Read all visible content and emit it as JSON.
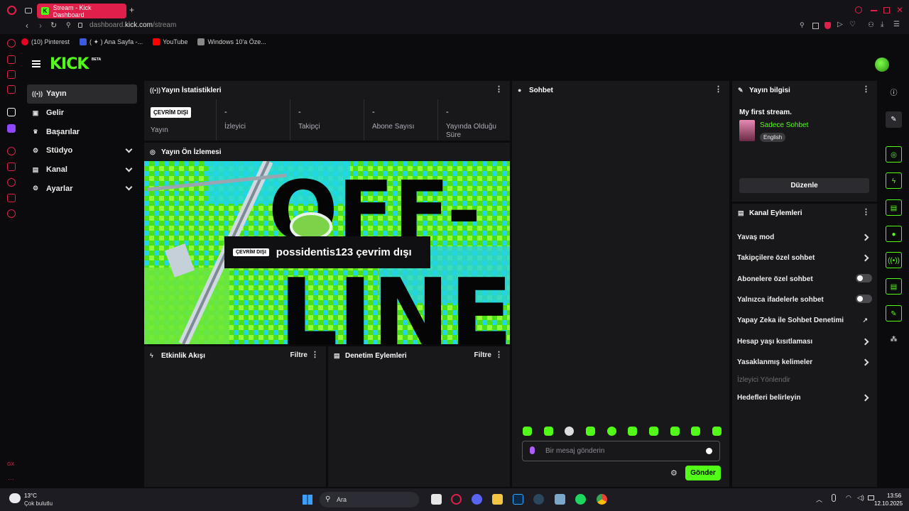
{
  "browser": {
    "tab_title": "Stream - Kick Dashboard",
    "url_host": "dashboard.",
    "url_domain": "kick.com",
    "url_path": "/stream",
    "bookmarks": [
      {
        "label": "(10) Pinterest",
        "color": "#e60023"
      },
      {
        "label": "( ✦ ) Ana Sayfa -...",
        "color": "#3b5bdb"
      },
      {
        "label": "YouTube",
        "color": "#ff0000"
      },
      {
        "label": "Windows 10'a Öze...",
        "color": "#888888"
      }
    ]
  },
  "app": {
    "logo": "KICK",
    "logo_badge": "BETA",
    "accent": "#53fc18"
  },
  "nav": {
    "items": [
      {
        "label": "Yayın",
        "icon": "broadcast-icon",
        "glyph": "((•))",
        "active": true,
        "expand": false
      },
      {
        "label": "Gelir",
        "icon": "revenue-icon",
        "glyph": "▣",
        "active": false,
        "expand": false
      },
      {
        "label": "Başarılar",
        "icon": "trophy-icon",
        "glyph": "🏆",
        "active": false,
        "expand": false
      },
      {
        "label": "Stüdyo",
        "icon": "studio-icon",
        "glyph": "⚙",
        "active": false,
        "expand": true
      },
      {
        "label": "Kanal",
        "icon": "channel-icon",
        "glyph": "▤",
        "active": false,
        "expand": true
      },
      {
        "label": "Ayarlar",
        "icon": "settings-icon",
        "glyph": "⚙",
        "active": false,
        "expand": true
      }
    ]
  },
  "stats": {
    "title": "Yayın İstatistikleri",
    "status_badge": "ÇEVRİM DIŞI",
    "items": [
      {
        "value": "",
        "label": "Yayın"
      },
      {
        "value": "-",
        "label": "İzleyici"
      },
      {
        "value": "-",
        "label": "Takipçi"
      },
      {
        "value": "-",
        "label": "Abone Sayısı"
      },
      {
        "value": "-",
        "label": "Yayında Olduğu Süre"
      }
    ]
  },
  "preview": {
    "title": "Yayın Ön İzlemesi",
    "badge": "ÇEVRİM DIŞI",
    "overlay_text": "possidentis123 çevrim dışı",
    "bg_text_1": "OFF-",
    "bg_text_2": "LINE"
  },
  "events": {
    "title": "Etkinlik Akışı",
    "filter": "Filtre"
  },
  "moderation": {
    "title": "Denetim Eylemleri",
    "filter": "Filtre"
  },
  "chat": {
    "title": "Sohbet",
    "placeholder": "Bir mesaj gönderin",
    "send": "Gönder"
  },
  "stream_info": {
    "title": "Yayın bilgisi",
    "stream_title": "My first stream.",
    "category": "Sadece Sohbet",
    "language": "English",
    "edit": "Düzenle"
  },
  "channel_actions": {
    "title": "Kanal Eylemleri",
    "items": [
      {
        "label": "Yavaş mod",
        "kind": "arrow"
      },
      {
        "label": "Takipçilere özel sohbet",
        "kind": "arrow"
      },
      {
        "label": "Abonelere özel sohbet",
        "kind": "toggle"
      },
      {
        "label": "Yalnızca ifadelerle sohbet",
        "kind": "toggle"
      },
      {
        "label": "Yapay Zeka ile Sohbet Denetimi",
        "kind": "external"
      },
      {
        "label": "Hesap yaşı kısıtlaması",
        "kind": "arrow"
      },
      {
        "label": "Yasaklanmış kelimeler",
        "kind": "arrow"
      },
      {
        "label": "İzleyici Yönlendir",
        "kind": "disabled"
      },
      {
        "label": "Hedefleri belirleyin",
        "kind": "arrow"
      }
    ]
  },
  "taskbar": {
    "weather_temp": "13°C",
    "weather_desc": "Çok bulutlu",
    "search": "Ara",
    "time": "13:56",
    "date": "12.10.2025"
  }
}
